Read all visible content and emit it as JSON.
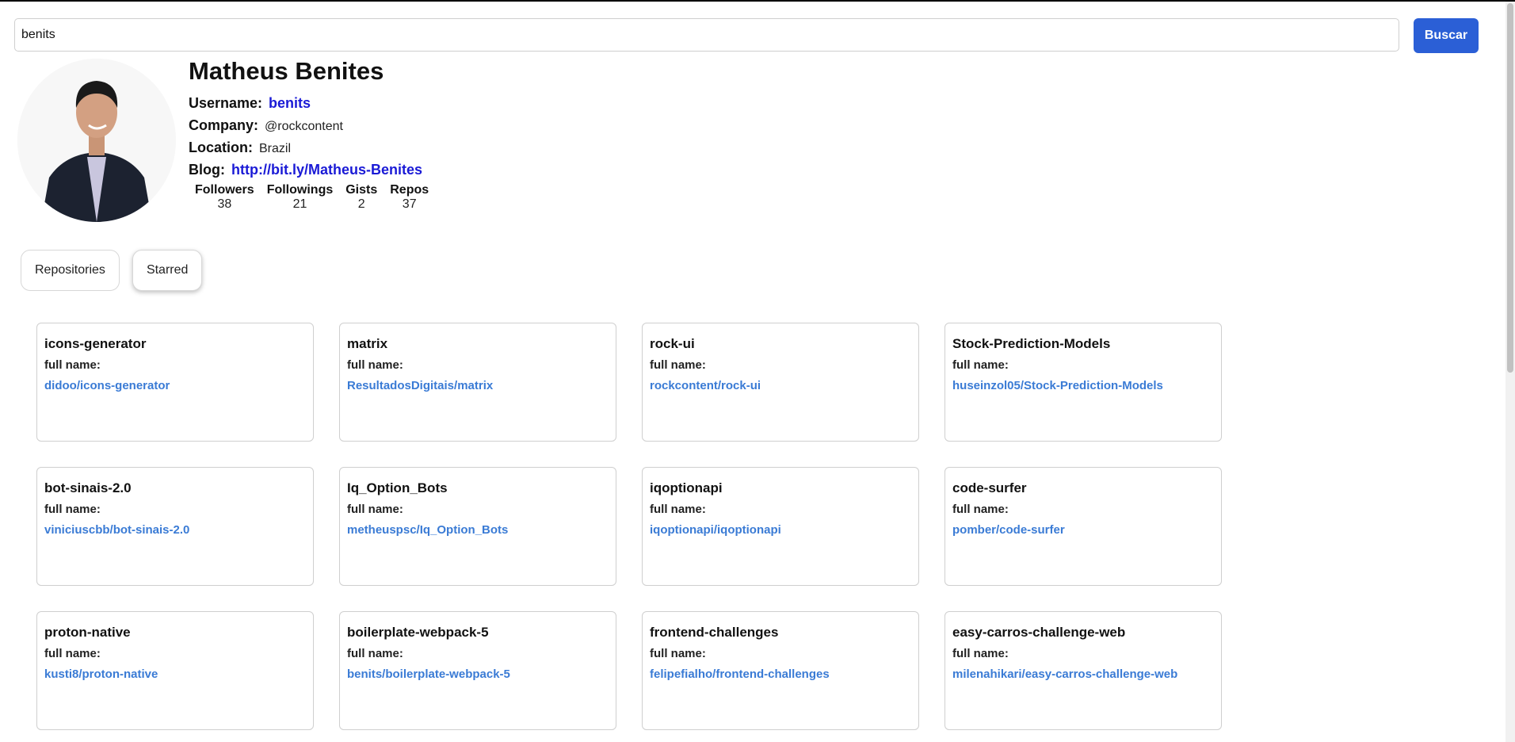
{
  "search": {
    "value": "benits",
    "button_label": "Buscar"
  },
  "profile": {
    "name": "Matheus Benites",
    "username_label": "Username:",
    "username": "benits",
    "company_label": "Company:",
    "company": "@rockcontent",
    "location_label": "Location:",
    "location": "Brazil",
    "blog_label": "Blog:",
    "blog": "http://bit.ly/Matheus-Benites",
    "stats": [
      {
        "label": "Followers",
        "value": "38"
      },
      {
        "label": "Followings",
        "value": "21"
      },
      {
        "label": "Gists",
        "value": "2"
      },
      {
        "label": "Repos",
        "value": "37"
      }
    ]
  },
  "tabs": [
    {
      "label": "Repositories",
      "active": false
    },
    {
      "label": "Starred",
      "active": true
    }
  ],
  "cards": [
    {
      "name": "icons-generator",
      "label": "full name:",
      "full_name": "didoo/icons-generator"
    },
    {
      "name": "matrix",
      "label": "full name:",
      "full_name": "ResultadosDigitais/matrix"
    },
    {
      "name": "rock-ui",
      "label": "full name:",
      "full_name": "rockcontent/rock-ui"
    },
    {
      "name": "Stock-Prediction-Models",
      "label": "full name:",
      "full_name": "huseinzol05/Stock-Prediction-Models"
    },
    {
      "name": "bot-sinais-2.0",
      "label": "full name:",
      "full_name": "viniciuscbb/bot-sinais-2.0"
    },
    {
      "name": "Iq_Option_Bots",
      "label": "full name:",
      "full_name": "metheuspsc/Iq_Option_Bots"
    },
    {
      "name": "iqoptionapi",
      "label": "full name:",
      "full_name": "iqoptionapi/iqoptionapi"
    },
    {
      "name": "code-surfer",
      "label": "full name:",
      "full_name": "pomber/code-surfer"
    },
    {
      "name": "proton-native",
      "label": "full name:",
      "full_name": "kusti8/proton-native"
    },
    {
      "name": "boilerplate-webpack-5",
      "label": "full name:",
      "full_name": "benits/boilerplate-webpack-5"
    },
    {
      "name": "frontend-challenges",
      "label": "full name:",
      "full_name": "felipefialho/frontend-challenges"
    },
    {
      "name": "easy-carros-challenge-web",
      "label": "full name:",
      "full_name": "milenahikari/easy-carros-challenge-web"
    }
  ]
}
